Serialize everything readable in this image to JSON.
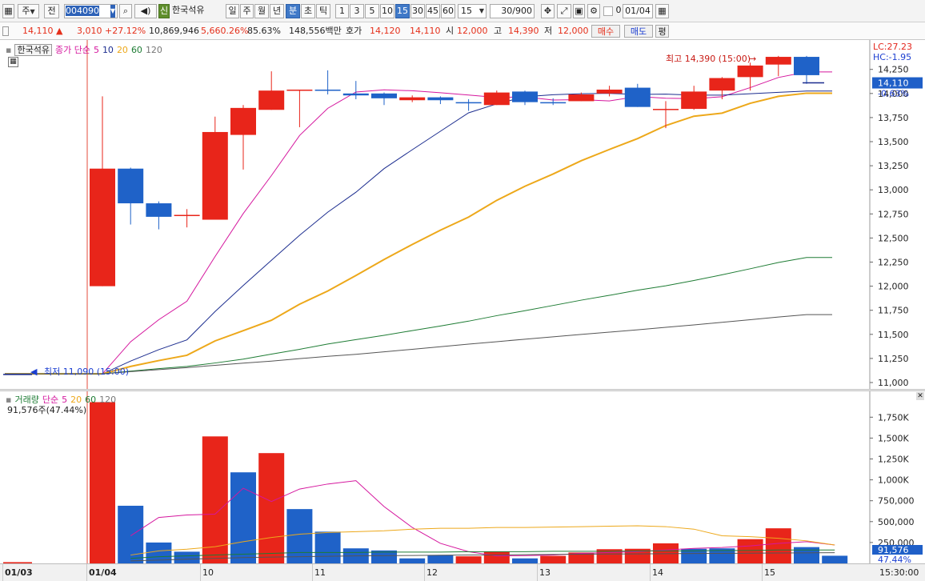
{
  "toolbar": {
    "type_label": "주",
    "view_label": "전",
    "stock_code": "004090",
    "stock_badge": "신",
    "stock_name": "한국석유",
    "periods": [
      "일",
      "주",
      "월",
      "년",
      "분",
      "초",
      "틱"
    ],
    "active_period": "분",
    "intervals": [
      "1",
      "3",
      "5",
      "10",
      "15",
      "30",
      "45",
      "60"
    ],
    "active_interval": "15",
    "interval_select": "15",
    "count_value": "30",
    "count_total": "/900",
    "checkbox_label": "0",
    "date_value": "01/04"
  },
  "quote": {
    "price": "14,110",
    "change": "3,010",
    "change_pct": "+27.12%",
    "volume": "10,869,946",
    "volume_pct": "5,660.26%",
    "turnover_pct": "85.63%",
    "amount": "148,556백만",
    "ask_bid_label": "호가",
    "ask": "14,120",
    "bid": "14,110",
    "open_label": "시",
    "open": "12,000",
    "high_label": "고",
    "high": "14,390",
    "low_label": "저",
    "low": "12,000",
    "buy_label": "매수",
    "sell_label": "매도",
    "even_label": "평"
  },
  "price_panel": {
    "name_tag": "한국석유",
    "ma_title": "종가 단순",
    "ma_periods": [
      "5",
      "10",
      "20",
      "60",
      "120"
    ],
    "lc": "LC:27.23",
    "hc": "HC:-1.95",
    "current_price_label": "14,110",
    "current_change_label": "-0.63%",
    "high_annotation": "최고 14,390 (15:00)",
    "low_annotation": "최저 11,090 (15:00)"
  },
  "volume_panel": {
    "title": "거래량",
    "ma_title": "단순",
    "ma_periods": [
      "5",
      "20",
      "60",
      "120"
    ],
    "last_value": "91,576주(47.44%)",
    "current_label": "91,576",
    "current_pct": "47.44%"
  },
  "x_axis": {
    "labels": [
      {
        "text": "01/03",
        "bold": true
      },
      {
        "text": "01/04",
        "bold": true
      },
      {
        "text": "10",
        "bold": false
      },
      {
        "text": "11",
        "bold": false
      },
      {
        "text": "12",
        "bold": false
      },
      {
        "text": "13",
        "bold": false
      },
      {
        "text": "14",
        "bold": false
      },
      {
        "text": "15",
        "bold": false
      }
    ],
    "time": "15:30:00"
  },
  "colors": {
    "up": "#e8251a",
    "down": "#1f62c8",
    "ma5": "#d5179e",
    "ma10": "#1c2d8f",
    "ma20": "#eda81a",
    "ma60": "#1e7c34",
    "ma120": "#555555"
  },
  "chart_data": [
    {
      "type": "candlestick",
      "ylim": [
        10900,
        14550
      ],
      "yticks": [
        "11,000",
        "11,250",
        "11,500",
        "11,750",
        "12,000",
        "12,250",
        "12,500",
        "12,750",
        "13,000",
        "13,250",
        "13,500",
        "13,750",
        "14,000",
        "14,250"
      ],
      "candles": [
        {
          "o": 11090,
          "c": 11090,
          "h": 11090,
          "l": 11090
        },
        {
          "o": 12000,
          "c": 13220,
          "h": 13970,
          "l": 12000
        },
        {
          "o": 13220,
          "c": 12860,
          "h": 13230,
          "l": 12640
        },
        {
          "o": 12860,
          "c": 12720,
          "h": 12880,
          "l": 12590
        },
        {
          "o": 12740,
          "c": 12740,
          "h": 12800,
          "l": 12610
        },
        {
          "o": 12690,
          "c": 13600,
          "h": 13760,
          "l": 12690
        },
        {
          "o": 13570,
          "c": 13850,
          "h": 13880,
          "l": 13210
        },
        {
          "o": 13830,
          "c": 14030,
          "h": 14230,
          "l": 13830
        },
        {
          "o": 14030,
          "c": 14040,
          "h": 14040,
          "l": 13650
        },
        {
          "o": 14040,
          "c": 14030,
          "h": 14240,
          "l": 13990
        },
        {
          "o": 14000,
          "c": 13980,
          "h": 14130,
          "l": 13940
        },
        {
          "o": 14000,
          "c": 13950,
          "h": 14010,
          "l": 13880
        },
        {
          "o": 13930,
          "c": 13960,
          "h": 13980,
          "l": 13910
        },
        {
          "o": 13960,
          "c": 13930,
          "h": 13970,
          "l": 13890
        },
        {
          "o": 13910,
          "c": 13900,
          "h": 13940,
          "l": 13820
        },
        {
          "o": 13880,
          "c": 14010,
          "h": 14030,
          "l": 13880
        },
        {
          "o": 14020,
          "c": 13910,
          "h": 14030,
          "l": 13880
        },
        {
          "o": 13910,
          "c": 13900,
          "h": 13950,
          "l": 13880
        },
        {
          "o": 13920,
          "c": 13990,
          "h": 14010,
          "l": 13920
        },
        {
          "o": 14000,
          "c": 14040,
          "h": 14080,
          "l": 13970
        },
        {
          "o": 14060,
          "c": 13860,
          "h": 14100,
          "l": 13860
        },
        {
          "o": 13830,
          "c": 13840,
          "h": 13920,
          "l": 13640
        },
        {
          "o": 13840,
          "c": 14020,
          "h": 14080,
          "l": 13830
        },
        {
          "o": 14030,
          "c": 14160,
          "h": 14170,
          "l": 13940
        },
        {
          "o": 14170,
          "c": 14290,
          "h": 14320,
          "l": 14030
        },
        {
          "o": 14300,
          "c": 14380,
          "h": 14390,
          "l": 14180
        },
        {
          "o": 14380,
          "c": 14190,
          "h": 14390,
          "l": 14100
        }
      ],
      "series": [
        {
          "name": "5",
          "values": [
            11090,
            11090,
            11423,
            11652,
            11844,
            12308,
            12754,
            13148,
            13564,
            13846,
            14015,
            14038,
            14028,
            14008,
            13984,
            13959,
            13964,
            13932,
            13936,
            13923,
            13968,
            13951,
            13946,
            13966,
            14061,
            14166,
            14224
          ]
        },
        {
          "name": "10",
          "values": [
            11090,
            11090,
            11223,
            11341,
            11443,
            11737,
            12007,
            12269,
            12528,
            12768,
            12975,
            13220,
            13416,
            13608,
            13799,
            13892,
            13966,
            13987,
            13997,
            14001,
            13990,
            13993,
            13983,
            13983,
            13997,
            14012,
            14025
          ]
        },
        {
          "name": "20",
          "values": [
            11090,
            11090,
            11167,
            11228,
            11283,
            11432,
            11538,
            11646,
            11813,
            11950,
            12111,
            12277,
            12433,
            12581,
            12717,
            12891,
            13037,
            13164,
            13302,
            13419,
            13532,
            13667,
            13764,
            13796,
            13898,
            13970,
            14003
          ]
        },
        {
          "name": "60",
          "values": [
            11090,
            11090,
            11118,
            11144,
            11167,
            11203,
            11243,
            11295,
            11345,
            11400,
            11445,
            11490,
            11539,
            11587,
            11637,
            11694,
            11745,
            11800,
            11855,
            11905,
            11958,
            12004,
            12059,
            12118,
            12181,
            12246,
            12298
          ]
        },
        {
          "name": "120",
          "values": [
            11090,
            11090,
            11113,
            11134,
            11155,
            11179,
            11201,
            11222,
            11248,
            11272,
            11293,
            11319,
            11345,
            11372,
            11399,
            11424,
            11450,
            11474,
            11499,
            11523,
            11547,
            11573,
            11598,
            11625,
            11652,
            11680,
            11705
          ]
        }
      ]
    },
    {
      "type": "bar",
      "ylim": [
        0,
        1950000
      ],
      "yticks": [
        "250,000",
        "500,000",
        "750,000",
        "1,000K",
        "1,250K",
        "1,500K",
        "1,750K"
      ],
      "values": [
        15000,
        1930000,
        690000,
        250000,
        140000,
        1520000,
        1090000,
        1320000,
        650000,
        380000,
        180000,
        155000,
        60000,
        100000,
        85000,
        140000,
        60000,
        90000,
        130000,
        170000,
        175000,
        240000,
        175000,
        180000,
        290000,
        420000,
        195000,
        91576
      ],
      "up": [
        true,
        true,
        false,
        false,
        false,
        true,
        false,
        true,
        false,
        false,
        false,
        false,
        false,
        false,
        true,
        true,
        false,
        true,
        true,
        true,
        true,
        true,
        false,
        false,
        true,
        true,
        false,
        false
      ],
      "series": [
        {
          "name": "5",
          "values": [
            null,
            null,
            330000,
            550000,
            580000,
            590000,
            900000,
            740000,
            890000,
            950000,
            990000,
            680000,
            430000,
            240000,
            140000,
            90000,
            92000,
            100000,
            120000,
            130000,
            140000,
            160000,
            180000,
            190000,
            210000,
            240000,
            260000,
            220000
          ]
        },
        {
          "name": "20",
          "values": [
            null,
            null,
            100000,
            150000,
            170000,
            200000,
            260000,
            310000,
            350000,
            370000,
            380000,
            390000,
            410000,
            420000,
            420000,
            430000,
            430000,
            435000,
            440000,
            445000,
            450000,
            440000,
            410000,
            330000,
            320000,
            300000,
            270000,
            220000
          ]
        },
        {
          "name": "60",
          "values": [
            null,
            null,
            60000,
            80000,
            90000,
            100000,
            110000,
            120000,
            130000,
            130000,
            130000,
            135000,
            135000,
            135000,
            140000,
            140000,
            140000,
            145000,
            145000,
            145000,
            150000,
            150000,
            150000,
            155000,
            155000,
            160000,
            160000,
            160000
          ]
        },
        {
          "name": "120",
          "values": [
            null,
            null,
            30000,
            40000,
            50000,
            60000,
            70000,
            75000,
            80000,
            85000,
            90000,
            92000,
            95000,
            98000,
            100000,
            102000,
            105000,
            108000,
            110000,
            112000,
            114000,
            116000,
            118000,
            120000,
            122000,
            124000,
            126000,
            128000
          ]
        }
      ]
    }
  ]
}
